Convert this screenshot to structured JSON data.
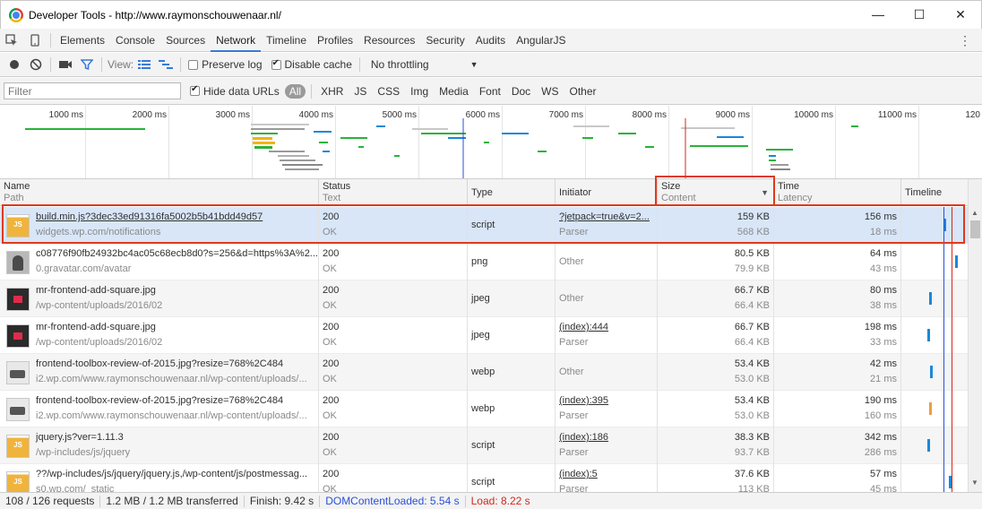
{
  "window": {
    "title": "Developer Tools - http://www.raymonschouwenaar.nl/",
    "minimize": "—",
    "maximize": "☐",
    "close": "✕"
  },
  "tabs": [
    "Elements",
    "Console",
    "Sources",
    "Network",
    "Timeline",
    "Profiles",
    "Resources",
    "Security",
    "Audits",
    "AngularJS"
  ],
  "active_tab": "Network",
  "toolbar": {
    "view_label": "View:",
    "preserve_log": "Preserve log",
    "disable_cache": "Disable cache",
    "throttling": "No throttling"
  },
  "filterbar": {
    "placeholder": "Filter",
    "hide_data_urls": "Hide data URLs",
    "types": [
      "All",
      "XHR",
      "JS",
      "CSS",
      "Img",
      "Media",
      "Font",
      "Doc",
      "WS",
      "Other"
    ]
  },
  "overview": {
    "ticks": [
      "1000 ms",
      "2000 ms",
      "3000 ms",
      "4000 ms",
      "5000 ms",
      "6000 ms",
      "7000 ms",
      "8000 ms",
      "9000 ms",
      "10000 ms",
      "11000 ms",
      "120"
    ]
  },
  "columns": {
    "name": "Name",
    "name_sub": "Path",
    "status": "Status",
    "status_sub": "Text",
    "type": "Type",
    "initiator": "Initiator",
    "size": "Size",
    "size_sub": "Content",
    "time": "Time",
    "time_sub": "Latency",
    "timeline": "Timeline"
  },
  "rows": [
    {
      "name": "build.min.js?3dec33ed91316fa5002b5b41bdd49d57",
      "path": "widgets.wp.com/notifications",
      "status": "200",
      "text": "OK",
      "type": "script",
      "initiator": "?jetpack=true&v=2...",
      "initiator2": "Parser",
      "size": "159 KB",
      "content": "568 KB",
      "time": "156 ms",
      "latency": "18 ms"
    },
    {
      "name": "c08776f90fb24932bc4ac05c68ecb8d0?s=256&d=https%3A%2...",
      "path": "0.gravatar.com/avatar",
      "status": "200",
      "text": "OK",
      "type": "png",
      "initiator": "Other",
      "initiator2": "",
      "size": "80.5 KB",
      "content": "79.9 KB",
      "time": "64 ms",
      "latency": "43 ms"
    },
    {
      "name": "mr-frontend-add-square.jpg",
      "path": "/wp-content/uploads/2016/02",
      "status": "200",
      "text": "OK",
      "type": "jpeg",
      "initiator": "Other",
      "initiator2": "",
      "size": "66.7 KB",
      "content": "66.4 KB",
      "time": "80 ms",
      "latency": "38 ms"
    },
    {
      "name": "mr-frontend-add-square.jpg",
      "path": "/wp-content/uploads/2016/02",
      "status": "200",
      "text": "OK",
      "type": "jpeg",
      "initiator": "(index):444",
      "initiator2": "Parser",
      "size": "66.7 KB",
      "content": "66.4 KB",
      "time": "198 ms",
      "latency": "33 ms"
    },
    {
      "name": "frontend-toolbox-review-of-2015.jpg?resize=768%2C484",
      "path": "i2.wp.com/www.raymonschouwenaar.nl/wp-content/uploads/...",
      "status": "200",
      "text": "OK",
      "type": "webp",
      "initiator": "Other",
      "initiator2": "",
      "size": "53.4 KB",
      "content": "53.0 KB",
      "time": "42 ms",
      "latency": "21 ms"
    },
    {
      "name": "frontend-toolbox-review-of-2015.jpg?resize=768%2C484",
      "path": "i2.wp.com/www.raymonschouwenaar.nl/wp-content/uploads/...",
      "status": "200",
      "text": "OK",
      "type": "webp",
      "initiator": "(index):395",
      "initiator2": "Parser",
      "size": "53.4 KB",
      "content": "53.0 KB",
      "time": "190 ms",
      "latency": "160 ms"
    },
    {
      "name": "jquery.js?ver=1.11.3",
      "path": "/wp-includes/js/jquery",
      "status": "200",
      "text": "OK",
      "type": "script",
      "initiator": "(index):186",
      "initiator2": "Parser",
      "size": "38.3 KB",
      "content": "93.7 KB",
      "time": "342 ms",
      "latency": "286 ms"
    },
    {
      "name": "??/wp-includes/js/jquery/jquery.js,/wp-content/js/postmessag...",
      "path": "s0.wp.com/_static",
      "status": "200",
      "text": "OK",
      "type": "script",
      "initiator": "(index):5",
      "initiator2": "Parser",
      "size": "37.6 KB",
      "content": "113 KB",
      "time": "57 ms",
      "latency": "45 ms"
    }
  ],
  "status": {
    "requests": "108 / 126 requests",
    "transferred": "1.2 MB / 1.2 MB transferred",
    "finish": "Finish: 9.42 s",
    "dcl": "DOMContentLoaded: 5.54 s",
    "load": "Load: 8.22 s"
  },
  "colors": {
    "accent": "#3879d9",
    "highlight": "#e0391b",
    "dcl": "#2a4fd8",
    "load": "#d4261d"
  }
}
